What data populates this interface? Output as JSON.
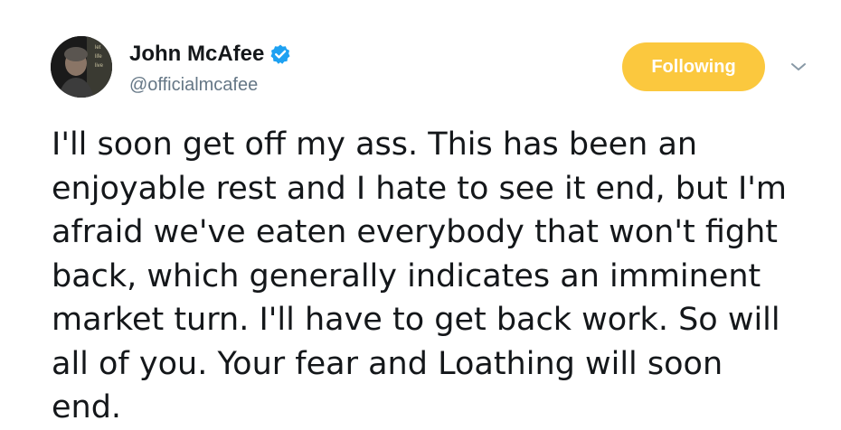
{
  "user": {
    "display_name": "John McAfee",
    "handle": "@officialmcafee",
    "verified": true,
    "avatar_icon": "profile-photo",
    "avatar_text": "let life live"
  },
  "actions": {
    "follow_label": "Following",
    "menu_icon": "chevron-down-icon"
  },
  "tweet": {
    "text": "I'll soon get off my ass. This has been an\nenjoyable rest and I hate to see it end, but I'm\nafraid we've eaten everybody that won't fight\nback, which generally indicates an imminent\nmarket turn. I'll have to get back work. So will\nall of you. Your fear and Loathing will soon\nend."
  },
  "colors": {
    "follow_bg": "#fbc83e",
    "verified_blue": "#1da1f2",
    "handle_gray": "#657786",
    "text": "#14171a"
  }
}
